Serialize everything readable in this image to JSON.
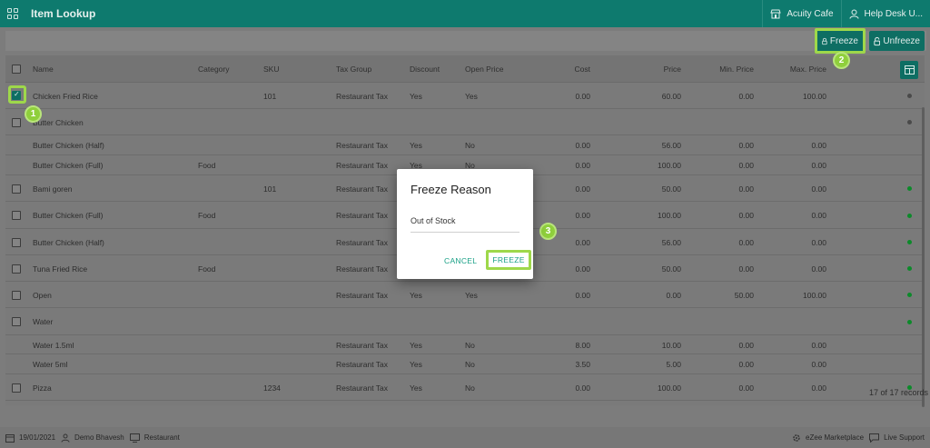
{
  "app": {
    "title": "Item Lookup",
    "property": "Acuity Cafe",
    "help": "Help Desk U..."
  },
  "toolbar": {
    "freeze_label": "Freeze",
    "unfreeze_label": "Unfreeze"
  },
  "table": {
    "headers": {
      "name": "Name",
      "category": "Category",
      "sku": "SKU",
      "tax_group": "Tax Group",
      "discount": "Discount",
      "open_price": "Open Price",
      "cost": "Cost",
      "price": "Price",
      "min_price": "Min. Price",
      "max_price": "Max. Price"
    },
    "rows": [
      {
        "name": "Chicken Fried Rice",
        "category": "",
        "sku": "101",
        "tax_group": "Restaurant Tax",
        "discount": "Yes",
        "open_price": "Yes",
        "cost": "0.00",
        "price": "60.00",
        "min_price": "0.00",
        "max_price": "100.00"
      },
      {
        "name": "Butter Chicken",
        "category": "",
        "sku": "",
        "tax_group": "",
        "discount": "",
        "open_price": "",
        "cost": "",
        "price": "",
        "min_price": "",
        "max_price": ""
      },
      {
        "name": "Butter Chicken (Half)",
        "category": "",
        "sku": "",
        "tax_group": "Restaurant Tax",
        "discount": "Yes",
        "open_price": "No",
        "cost": "0.00",
        "price": "56.00",
        "min_price": "0.00",
        "max_price": "0.00"
      },
      {
        "name": "Butter Chicken (Full)",
        "category": "Food",
        "sku": "",
        "tax_group": "Restaurant Tax",
        "discount": "Yes",
        "open_price": "No",
        "cost": "0.00",
        "price": "100.00",
        "min_price": "0.00",
        "max_price": "0.00"
      },
      {
        "name": "Bami goren",
        "category": "",
        "sku": "101",
        "tax_group": "Restaurant Tax",
        "discount": "",
        "open_price": "",
        "cost": "0.00",
        "price": "50.00",
        "min_price": "0.00",
        "max_price": "0.00"
      },
      {
        "name": "Butter Chicken (Full)",
        "category": "Food",
        "sku": "",
        "tax_group": "Restaurant Tax",
        "discount": "",
        "open_price": "",
        "cost": "0.00",
        "price": "100.00",
        "min_price": "0.00",
        "max_price": "0.00"
      },
      {
        "name": "Butter Chicken (Half)",
        "category": "",
        "sku": "",
        "tax_group": "Restaurant Tax",
        "discount": "",
        "open_price": "",
        "cost": "0.00",
        "price": "56.00",
        "min_price": "0.00",
        "max_price": "0.00"
      },
      {
        "name": "Tuna Fried Rice",
        "category": "Food",
        "sku": "",
        "tax_group": "Restaurant Tax",
        "discount": "",
        "open_price": "",
        "cost": "0.00",
        "price": "50.00",
        "min_price": "0.00",
        "max_price": "0.00"
      },
      {
        "name": "Open",
        "category": "",
        "sku": "",
        "tax_group": "Restaurant Tax",
        "discount": "Yes",
        "open_price": "Yes",
        "cost": "0.00",
        "price": "0.00",
        "min_price": "50.00",
        "max_price": "100.00"
      },
      {
        "name": "Water",
        "category": "",
        "sku": "",
        "tax_group": "",
        "discount": "",
        "open_price": "",
        "cost": "",
        "price": "",
        "min_price": "",
        "max_price": ""
      },
      {
        "name": "Water 1.5ml",
        "category": "",
        "sku": "",
        "tax_group": "Restaurant Tax",
        "discount": "Yes",
        "open_price": "No",
        "cost": "8.00",
        "price": "10.00",
        "min_price": "0.00",
        "max_price": "0.00"
      },
      {
        "name": "Water 5ml",
        "category": "",
        "sku": "",
        "tax_group": "Restaurant Tax",
        "discount": "Yes",
        "open_price": "No",
        "cost": "3.50",
        "price": "5.00",
        "min_price": "0.00",
        "max_price": "0.00"
      },
      {
        "name": "Pizza",
        "category": "",
        "sku": "1234",
        "tax_group": "Restaurant Tax",
        "discount": "Yes",
        "open_price": "No",
        "cost": "0.00",
        "price": "100.00",
        "min_price": "0.00",
        "max_price": "0.00"
      }
    ],
    "records_label": "17 of 17 records"
  },
  "modal": {
    "title": "Freeze Reason",
    "reason_value": "Out of Stock",
    "cancel_label": "CANCEL",
    "freeze_label": "FREEZE"
  },
  "markers": {
    "one": "1",
    "two": "2",
    "three": "3"
  },
  "footer": {
    "date": "19/01/2021",
    "user": "Demo Bhavesh",
    "outlet": "Restaurant",
    "marketplace": "eZee Marketplace",
    "support": "Live Support"
  },
  "colors": {
    "brand": "#0e7a6e",
    "highlight": "#9ed84a",
    "accent_text": "#19a086"
  }
}
